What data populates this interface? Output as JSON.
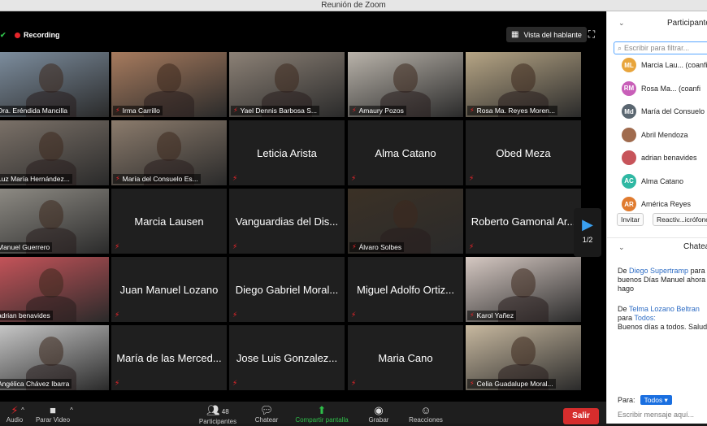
{
  "window": {
    "title": "Reunión de Zoom"
  },
  "status": {
    "recording": "Recording",
    "speaker_view": "Vista del hablante",
    "page": "1/2"
  },
  "tiles": [
    {
      "name": "Dra. Eréndida Mancilla",
      "active": true,
      "video": true,
      "bg": "#7e8fa0"
    },
    {
      "name": "Irma Carrillo",
      "video": true,
      "bg": "#a77b5e"
    },
    {
      "name": "Yael Dennis Barbosa S...",
      "video": true,
      "bg": "#8c8176"
    },
    {
      "name": "Amaury Pozos",
      "video": true,
      "bg": "#b9b3aa"
    },
    {
      "name": "Rosa Ma. Reyes Moren...",
      "video": true,
      "bg": "#b6a585"
    },
    {
      "name": "Luz María Hernández...",
      "video": true,
      "bg": "#7c7269"
    },
    {
      "name": "María del Consuelo Es...",
      "video": true,
      "bg": "#8b7b6c"
    },
    {
      "name": "Leticia Arista",
      "video": false
    },
    {
      "name": "Alma Catano",
      "video": false
    },
    {
      "name": "Obed Meza",
      "video": false
    },
    {
      "name": "Manuel Guerrero",
      "video": true,
      "bg": "#8f8c85"
    },
    {
      "name": "Marcia Lausen",
      "video": false
    },
    {
      "name": "Vanguardias del Dis...",
      "video": false
    },
    {
      "name": "Álvaro Solbes",
      "video": true,
      "bg": "#3b3126"
    },
    {
      "name": "Roberto Gamonal Ar...",
      "video": false
    },
    {
      "name": "adrian benavides",
      "video": true,
      "bg": "#c7545a"
    },
    {
      "name": "Juan Manuel Lozano",
      "video": false
    },
    {
      "name": "Diego Gabriel Moral...",
      "video": false
    },
    {
      "name": "Miguel Adolfo Ortiz...",
      "video": false
    },
    {
      "name": "Karol Yañez",
      "video": true,
      "bg": "#d5c8c2"
    },
    {
      "name": "Angélica Chávez Ibarra",
      "video": true,
      "bg": "#c9c9c9"
    },
    {
      "name": "María de las Merced...",
      "video": false
    },
    {
      "name": "Jose Luis Gonzalez...",
      "video": false
    },
    {
      "name": "Maria Cano",
      "video": false
    },
    {
      "name": "Celia Guadalupe Moral...",
      "video": true,
      "bg": "#c7b89f"
    }
  ],
  "toolbar": {
    "audio": "Audio",
    "video": "Parar Video",
    "participants": "Participantes",
    "participants_count": "48",
    "chat": "Chatear",
    "share": "Compartir pantalla",
    "record": "Grabar",
    "reactions": "Reacciones",
    "exit": "Salir"
  },
  "sidebar": {
    "participants_title": "Participantes",
    "filter_placeholder": "Escribir para filtrar...",
    "people": [
      {
        "initials": "ML",
        "name": "Marcia Lau... (coanfi",
        "color": "#e8a53c"
      },
      {
        "initials": "RM",
        "name": "Rosa Ma... (coanfi",
        "color": "#c85fb8"
      },
      {
        "initials": "Md",
        "name": "María del Consuelo",
        "color": "#5a6670"
      },
      {
        "initials": "",
        "name": "Abril Mendoza",
        "color": "#a06b4e"
      },
      {
        "initials": "",
        "name": "adrian benavides",
        "color": "#c7545a"
      },
      {
        "initials": "AC",
        "name": "Alma Catano",
        "color": "#2fb8a3"
      },
      {
        "initials": "AR",
        "name": "América Reyes",
        "color": "#e07b2f"
      }
    ],
    "invite": "Invitar",
    "reactivate": "Reactiv...icrófono",
    "chat_title": "Chatea",
    "messages": [
      {
        "prefix": "De ",
        "from": "Diego Supertramp",
        "mid": " para",
        "text": "buenos Días Manuel ahora lo hago"
      },
      {
        "prefix": "De ",
        "from": "Telma Lozano Beltran",
        "mid": " para ",
        "to": "Todos",
        "colon": ":",
        "text": "Buenos días a todos. Salud"
      }
    ],
    "to_label": "Para:",
    "to_value": "Todos ▾",
    "message_placeholder": "Escribir mensaje aquí..."
  }
}
